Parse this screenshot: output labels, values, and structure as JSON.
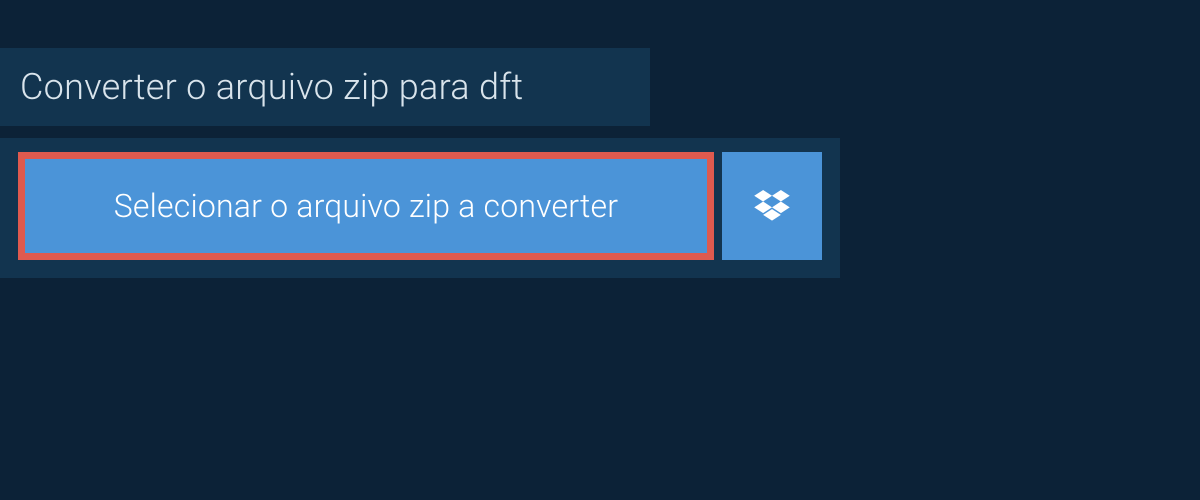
{
  "title": "Converter o arquivo zip para dft",
  "selectButton": "Selecionar o arquivo zip a converter",
  "colors": {
    "background": "#0c2237",
    "panel": "#12344f",
    "buttonBg": "#4b94d8",
    "buttonBorder": "#de5a4f",
    "text": "#d9e4ec"
  }
}
